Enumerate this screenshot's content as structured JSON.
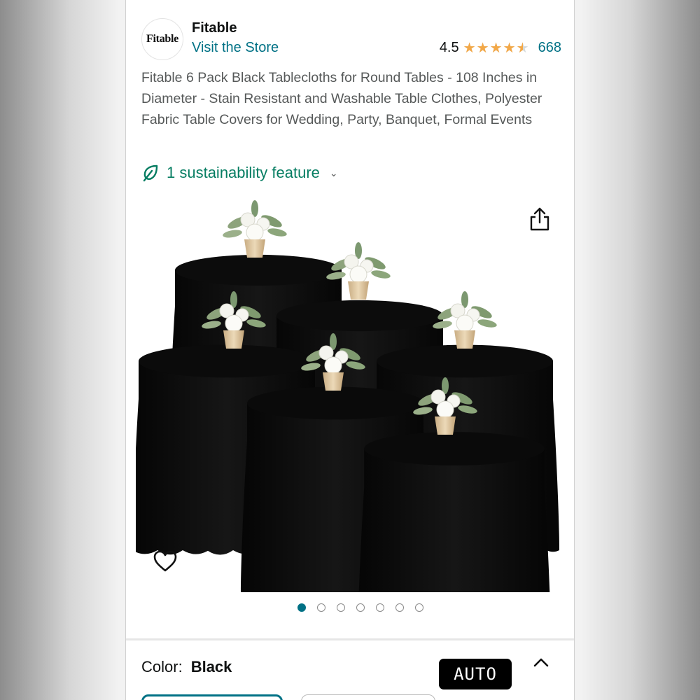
{
  "store": {
    "logo_text": "Fitable",
    "name": "Fitable",
    "visit_label": "Visit the Store"
  },
  "rating": {
    "value_label": "4.5",
    "value": 4.5,
    "max": 5,
    "count": "668",
    "star_color": "#f3a847"
  },
  "product": {
    "title": "Fitable 6 Pack Black Tablecloths for Round Tables - 108 Inches in Diameter - Stain Resistant and Washable Table Clothes, Polyester Fabric Table Covers for Wedding, Party, Banquet, Formal Events"
  },
  "sustainability": {
    "label": "1 sustainability feature",
    "icon": "leaf-icon",
    "color": "#067d62"
  },
  "gallery": {
    "image_count": 7,
    "active_index": 0
  },
  "variation": {
    "color_label": "Color:",
    "color_value": "Black"
  },
  "overlay": {
    "auto_label": "AUTO"
  },
  "theme": {
    "link_color": "#007185",
    "text_color": "#0f1111",
    "muted_text": "#565959"
  }
}
